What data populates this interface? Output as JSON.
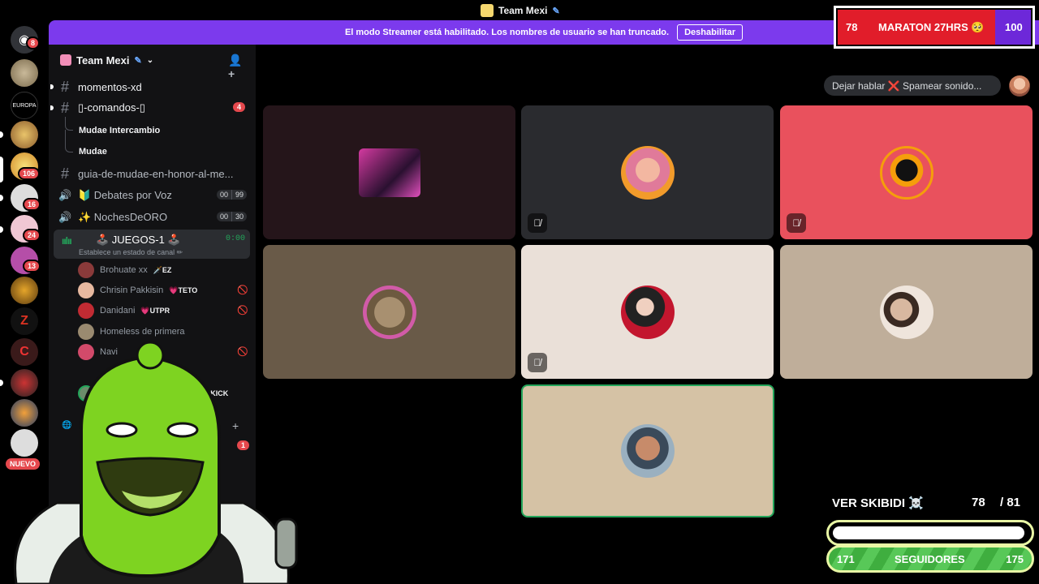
{
  "window": {
    "title": "Team Mexi"
  },
  "banner": {
    "text": "El modo Streamer está habilitado. Los nombres de usuario se han truncado.",
    "button": "Deshabilitar"
  },
  "rail": {
    "badges": [
      "8",
      "106",
      "16",
      "24",
      "13"
    ],
    "nuevo": "NUEVO"
  },
  "server": {
    "name": "Team Mexi"
  },
  "channels": {
    "momentos": "momentos-xd",
    "comandos": "▯-comandos-▯",
    "comandos_unread": "4",
    "thread1": "Mudae Intercambio",
    "thread2": "Mudae",
    "guia": "guia-de-mudae-en-honor-al-me...",
    "debates": "🔰 Debates por Voz",
    "debates_count": [
      "00",
      "99"
    ],
    "noches": "✨ NochesDeORO",
    "noches_count": [
      "00",
      "30"
    ],
    "juegos": "🕹️ JUEGOS-1 🕹️",
    "juegos_status": "Establece un estado de canal ✏",
    "juegos_timer": "0:00",
    "hidden_unread": "1"
  },
  "voice_users": [
    {
      "name": "Brohuate xx",
      "tag": "🗡️EZ",
      "muted": false
    },
    {
      "name": "Chrisin Pakkisin",
      "tag": "💗TETO",
      "muted": true
    },
    {
      "name": "Danidani",
      "tag": "💗UTPR",
      "muted": true
    },
    {
      "name": "Homeless de primera",
      "tag": "",
      "muted": false
    },
    {
      "name": "Navi",
      "tag": "",
      "muted": true
    }
  ],
  "kick_tag": "💚KICK",
  "status_pill": "Dejar hablar ❌ Spamear sonido...",
  "overlay": {
    "maraton_left": "78",
    "maraton_text": "MARATON 27HRS 🥺",
    "maraton_right": "100",
    "skibidi_label": "VER SKIBIDI ☠️",
    "skibidi_count": "78",
    "skibidi_total": "/ 81",
    "seguidores_left": "171",
    "seguidores_label": "SEGUIDORES",
    "seguidores_right": "175"
  },
  "colors": {
    "accent": "#7c3aed",
    "speaking": "#23a55a",
    "mention": "#e5484d"
  }
}
